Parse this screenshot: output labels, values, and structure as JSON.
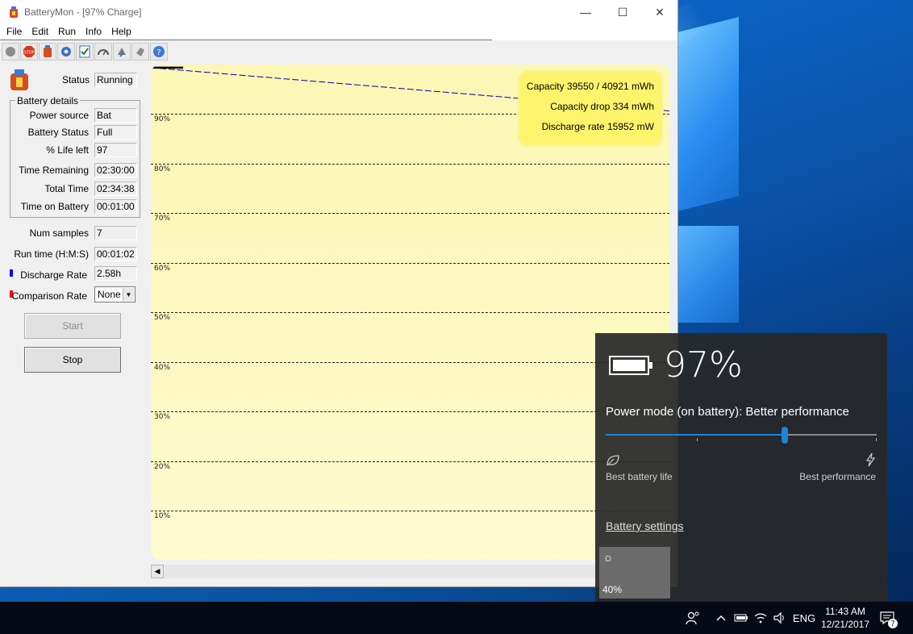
{
  "window": {
    "title": "BatteryMon - [97% Charge]",
    "controls": {
      "minimize": "—",
      "maximize": "☐",
      "close": "✕"
    }
  },
  "menu": [
    "File",
    "Edit",
    "Run",
    "Info",
    "Help"
  ],
  "toolbar": {
    "icons": [
      "record-icon",
      "stop-icon",
      "battery-icon",
      "settings-icon",
      "checklist-icon",
      "gauge-icon",
      "refresh-icon",
      "pointer-icon",
      "help-icon"
    ]
  },
  "panel": {
    "status_label": "Status",
    "status_value": "Running",
    "group_title": "Battery details",
    "power_source_label": "Power source",
    "power_source_value": "Bat",
    "battery_status_label": "Battery Status",
    "battery_status_value": "Full",
    "life_left_label": "% Life left",
    "life_left_value": "97",
    "time_remaining_label": "Time Remaining",
    "time_remaining_value": "02:30:00",
    "total_time_label": "Total Time",
    "total_time_value": "02:34:38",
    "time_on_battery_label": "Time on Battery",
    "time_on_battery_value": "00:01:00",
    "num_samples_label": "Num samples",
    "num_samples_value": "7",
    "run_time_label": "Run time (H:M:S)",
    "run_time_value": "00:01:02",
    "discharge_rate_label": "Discharge Rate",
    "discharge_rate_value": "2.58h",
    "comparison_rate_label": "Comparison Rate",
    "comparison_rate_value": "None",
    "start_label": "Start",
    "stop_label": "Stop",
    "colors": {
      "discharge_marker": "#0000ff",
      "comparison_marker": "#ff0000"
    }
  },
  "chart_info": {
    "capacity": "Capacity 39550 / 40921 mWh",
    "capacity_drop": "Capacity drop 334 mWh",
    "discharge_rate": "Discharge rate 15952 mW"
  },
  "chart_data": {
    "type": "line",
    "ylim": [
      0,
      100
    ],
    "y_ticks": [
      "90%",
      "80%",
      "70%",
      "60%",
      "50%",
      "40%",
      "30%",
      "20%",
      "10%"
    ],
    "series": [
      {
        "values": [
          97,
          97
        ],
        "color": "#000000"
      },
      {
        "values": [
          97,
          88.5
        ],
        "color": "#0000aa"
      }
    ]
  },
  "flyout": {
    "percent": "97%",
    "mode": "Power mode (on battery): Better performance",
    "slider_position": 0.66,
    "left_label": "Best battery life",
    "right_label": "Best performance",
    "settings_link": "Battery settings",
    "brightness": "40%"
  },
  "taskbar": {
    "language": "ENG",
    "time": "11:43 AM",
    "date": "12/21/2017",
    "notification_count": "7"
  }
}
